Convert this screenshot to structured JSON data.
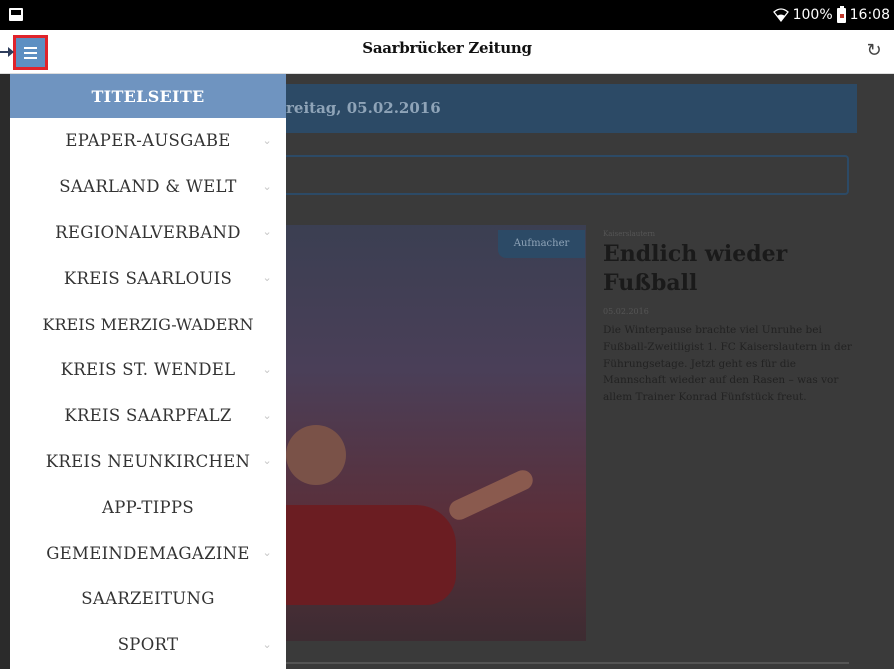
{
  "status_bar": {
    "battery": "100%",
    "time": "16:08",
    "icons": [
      "notification-icon",
      "wifi-icon",
      "battery-icon"
    ]
  },
  "app_bar": {
    "logo": "Saarbrücker Zeitung",
    "menu_icon": "hamburger-menu-icon",
    "refresh_icon": "refresh-icon",
    "accent_color": "#5d8fc2",
    "highlight_color": "#e0232b"
  },
  "drawer": {
    "items": [
      {
        "label": "TITELSEITE",
        "active": true,
        "expandable": false
      },
      {
        "label": "EPAPER-AUSGABE",
        "active": false,
        "expandable": true
      },
      {
        "label": "SAARLAND & WELT",
        "active": false,
        "expandable": true
      },
      {
        "label": "REGIONALVERBAND",
        "active": false,
        "expandable": true
      },
      {
        "label": "KREIS SAARLOUIS",
        "active": false,
        "expandable": true
      },
      {
        "label": "KREIS MERZIG-WADERN",
        "active": false,
        "expandable": false
      },
      {
        "label": "KREIS ST. WENDEL",
        "active": false,
        "expandable": true
      },
      {
        "label": "KREIS SAARPFALZ",
        "active": false,
        "expandable": true
      },
      {
        "label": "KREIS NEUNKIRCHEN",
        "active": false,
        "expandable": true
      },
      {
        "label": "APP-TIPPS",
        "active": false,
        "expandable": false
      },
      {
        "label": "GEMEINDEMAGAZINE",
        "active": false,
        "expandable": true
      },
      {
        "label": "SAARZEITUNG",
        "active": false,
        "expandable": false
      },
      {
        "label": "SPORT",
        "active": false,
        "expandable": true
      }
    ],
    "active_color": "#6f94c0"
  },
  "content": {
    "date_banner": "reitag, 05.02.2016",
    "badge": "Aufmacher",
    "kicker": "Kaiserslautern",
    "headline": "Endlich wieder Fußball",
    "article_date": "05.02.2016",
    "teaser": "Die Winterpause brachte viel Unruhe bei Fußball-Zweitligist 1. FC Kaiserslautern in der Führungsetage. Jetzt geht es für die Mannschaft wieder auf den Rasen – was vor allem Trainer Konrad Fünfstück freut."
  }
}
